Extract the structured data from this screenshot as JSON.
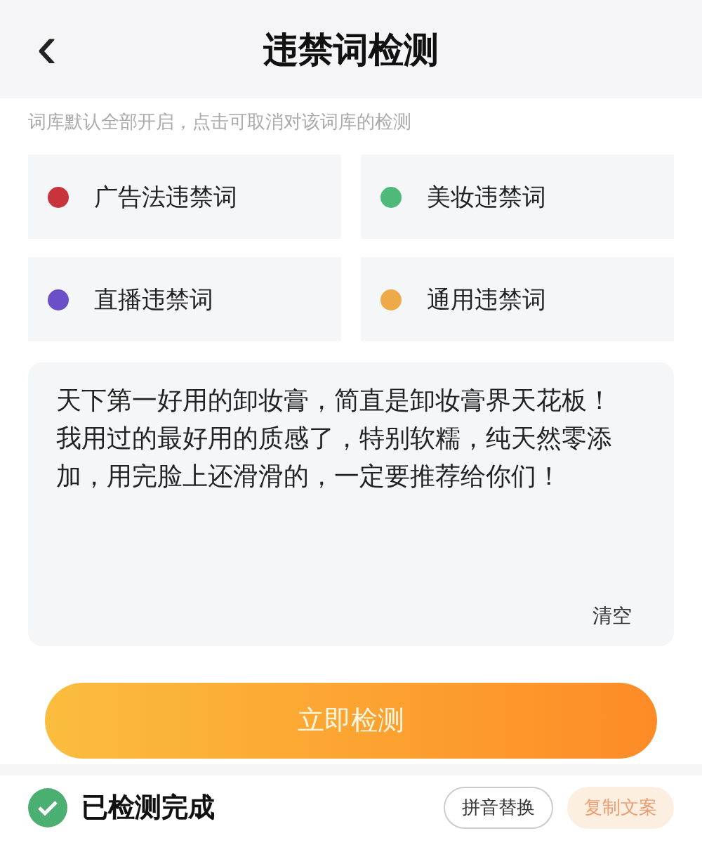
{
  "header": {
    "back": "‹",
    "title": "违禁词检测"
  },
  "hint": "词库默认全部开启，点击可取消对该词库的检测",
  "libraries": [
    {
      "label": "广告法违禁词",
      "color": "#c8343c"
    },
    {
      "label": "美妆违禁词",
      "color": "#4fb97a"
    },
    {
      "label": "直播违禁词",
      "color": "#6a4fc8"
    },
    {
      "label": "通用违禁词",
      "color": "#eeaa48"
    }
  ],
  "editor": {
    "value": "天下第一好用的卸妆膏，简直是卸妆膏界天花板！我用过的最好用的质感了，特别软糯，纯天然零添加，用完脸上还滑滑的，一定要推荐给你们！",
    "clear": "清空"
  },
  "check_button": "立即检测",
  "result": {
    "status": "已检测完成",
    "actions": [
      {
        "label": "拼音替换",
        "kind": "outline"
      },
      {
        "label": "复制文案",
        "kind": "tinted"
      }
    ]
  }
}
